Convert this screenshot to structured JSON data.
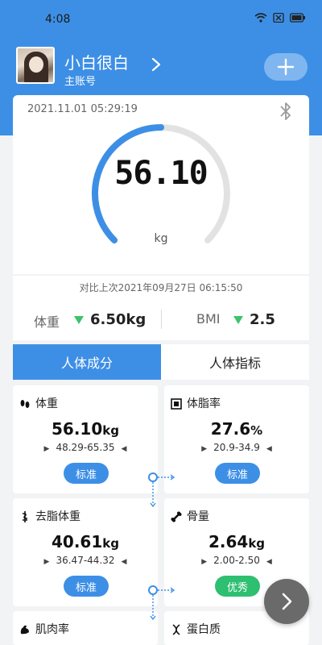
{
  "status": {
    "time": "4:08"
  },
  "user": {
    "name": "小白很白",
    "account_type": "主账号"
  },
  "measurement": {
    "datetime": "2021.11.01 05:29:19",
    "weight": "56.10",
    "unit": "kg",
    "gauge_fraction": 0.5
  },
  "comparison": {
    "title": "对比上次2021年09月27日 06:15:50",
    "weight_label": "体重",
    "weight_value": "6.50kg",
    "bmi_label": "BMI",
    "bmi_value": "2.5",
    "trend_color": "#3cc36b"
  },
  "tabs": [
    {
      "label": "人体成分",
      "active": true
    },
    {
      "label": "人体指标",
      "active": false
    }
  ],
  "metrics": [
    {
      "title": "体重",
      "icon": "footprints-icon",
      "value": "56.10",
      "unit": "kg",
      "range": "48.29-65.35",
      "badge": "标准",
      "badge_color": "#3d8fe6"
    },
    {
      "title": "体脂率",
      "icon": "fat-rate-icon",
      "value": "27.6",
      "unit": "%",
      "range": "20.9-34.9",
      "badge": "标准",
      "badge_color": "#3d8fe6"
    },
    {
      "title": "去脂体重",
      "icon": "lean-mass-icon",
      "value": "40.61",
      "unit": "kg",
      "range": "36.47-44.32",
      "badge": "标准",
      "badge_color": "#3d8fe6"
    },
    {
      "title": "骨量",
      "icon": "bone-icon",
      "value": "2.64",
      "unit": "kg",
      "range": "2.00-2.50",
      "badge": "优秀",
      "badge_color": "#2fbf71"
    },
    {
      "title": "肌肉率",
      "icon": "muscle-icon"
    },
    {
      "title": "蛋白质",
      "icon": "protein-icon"
    }
  ],
  "colors": {
    "primary": "#3d8fe6",
    "good": "#2fbf71",
    "gauge_track": "#e2e2e2"
  }
}
